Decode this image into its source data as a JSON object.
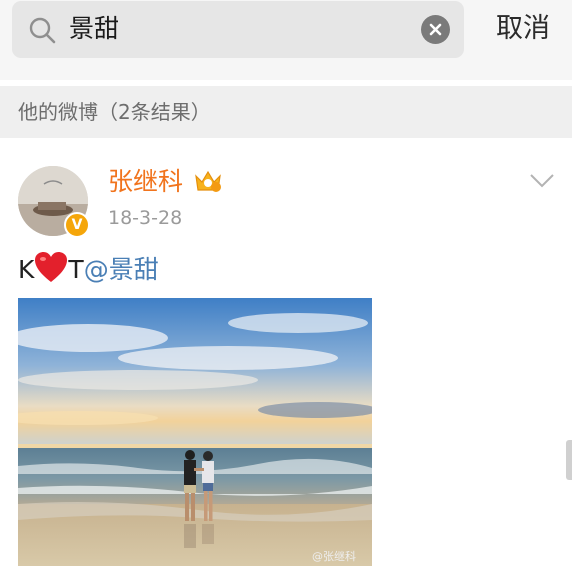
{
  "search": {
    "query": "景甜",
    "cancel_label": "取消"
  },
  "section": {
    "title": "他的微博（2条结果）"
  },
  "post": {
    "author": "张继科",
    "verified_badge": "V",
    "date": "18-3-28",
    "text_before_heart": "K",
    "text_after_heart": "T",
    "mention": "@景甜",
    "watermark": "@张继科"
  },
  "icons": {
    "search": "search-icon",
    "clear": "clear-icon",
    "crown": "vip-crown-icon",
    "chevron": "chevron-down-icon",
    "heart": "heart-icon"
  },
  "colors": {
    "author": "#f1741d",
    "mention": "#4a7fb5",
    "badge": "#f5a60a"
  }
}
